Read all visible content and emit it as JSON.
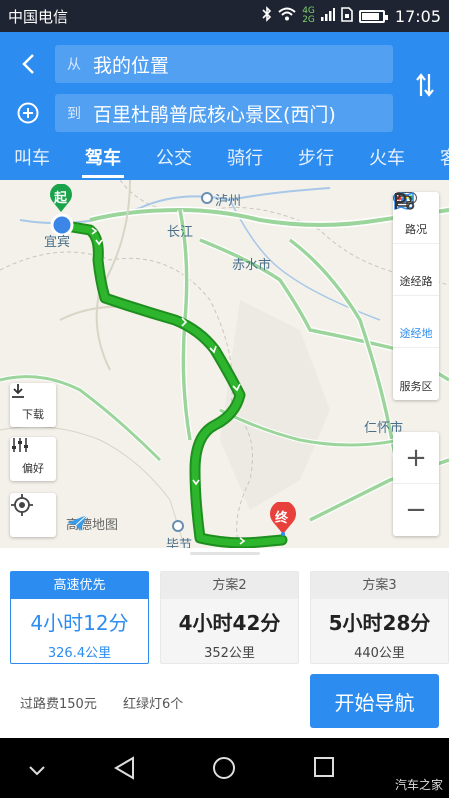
{
  "status_bar": {
    "carrier": "中国电信",
    "network_top": "4G",
    "network_bottom": "2G",
    "time": "17:05",
    "battery_level": 0.85
  },
  "route": {
    "from_prefix": "从",
    "from_value": "我的位置",
    "to_prefix": "到",
    "to_value": "百里杜鹃普底核心景区(西门)"
  },
  "tabs": [
    {
      "label": "叫车"
    },
    {
      "label": "驾车"
    },
    {
      "label": "公交"
    },
    {
      "label": "骑行"
    },
    {
      "label": "步行"
    },
    {
      "label": "火车"
    },
    {
      "label": "客"
    }
  ],
  "active_tab": "驾车",
  "map": {
    "start_marker": "起",
    "end_marker": "终",
    "cities": {
      "yibin": "宜宾",
      "luzhou": "泸州",
      "changjiang": "长江",
      "chishui": "赤水市",
      "renhuai": "仁怀市",
      "bijie": "毕节"
    },
    "logo": "高德地图",
    "route_color": "#2eb52e"
  },
  "right_tools": {
    "traffic": "路况",
    "waypoint_route": "途经路",
    "waypoint_place": "途经地",
    "service_area": "服务区"
  },
  "left_tools": {
    "download": "下载",
    "preference": "偏好"
  },
  "zoom": {
    "in": "+",
    "out": "−"
  },
  "plans": [
    {
      "head": "高速优先",
      "time": "4小时12分",
      "distance": "326.4公里"
    },
    {
      "head": "方案2",
      "time": "4小时42分",
      "distance": "352公里"
    },
    {
      "head": "方案3",
      "time": "5小时28分",
      "distance": "440公里"
    }
  ],
  "summary": {
    "toll": "过路费150元",
    "lights": "红绿灯6个"
  },
  "start_button": "开始导航",
  "watermark": "汽车之家",
  "colors": {
    "accent": "#2d8cf0",
    "route": "#2eb52e",
    "end_marker": "#e8413c"
  }
}
